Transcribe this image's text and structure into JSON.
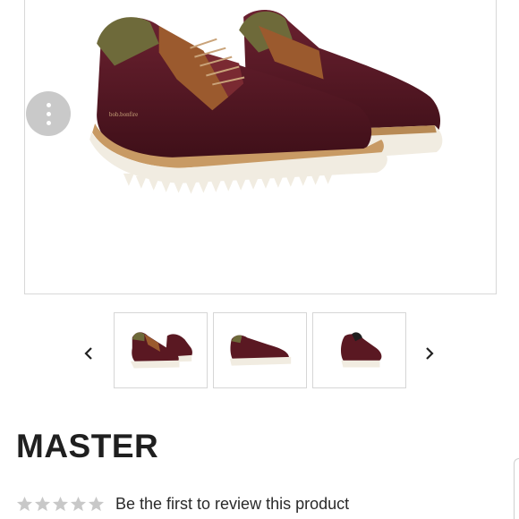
{
  "product": {
    "title": "MASTER",
    "image_alt_subject": "burgundy leather lace-up shoes with olive collar and white serrated sole"
  },
  "gallery": {
    "menu_icon": "more-vertical-icon",
    "prev_icon": "chevron-left-icon",
    "next_icon": "chevron-right-icon",
    "thumbnails": [
      "pair-angled-view",
      "side-view",
      "front-view"
    ]
  },
  "rating": {
    "stars_total": 5,
    "stars_filled": 0,
    "review_text": "Be the first to review this product"
  },
  "colors": {
    "leather": "#5a1822",
    "tan": "#9b5a2e",
    "olive": "#6e6a3a",
    "sole": "#f1ece1",
    "star_empty": "#c8c8c8"
  }
}
